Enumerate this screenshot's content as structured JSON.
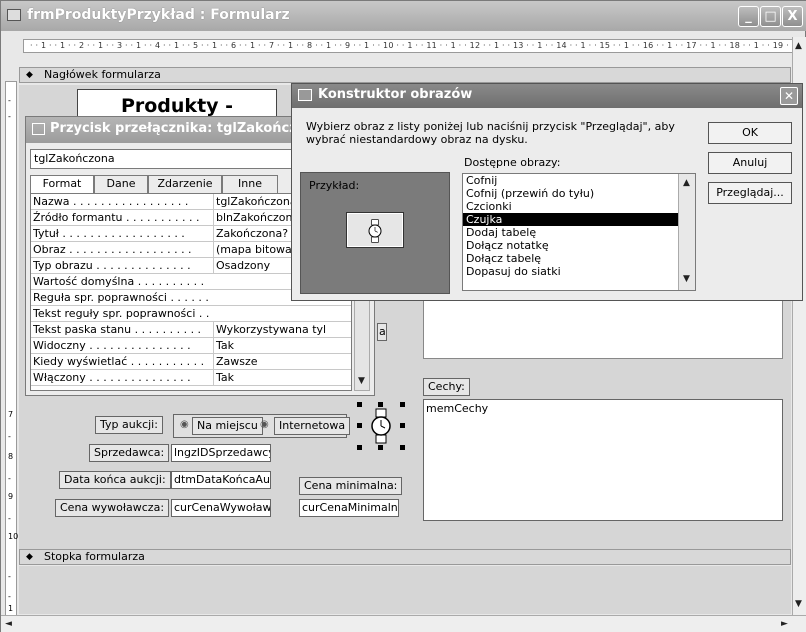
{
  "window": {
    "title": "frmProduktyPrzykład : Formularz",
    "buttons": {
      "minimize": "_",
      "maximize": "□",
      "close": "X"
    }
  },
  "ruler": {
    "horizontal": "· · 1 · · 1 · · 2 · · 1 · · 3 · · 1 · · 4 · · 1 · · 5 · · 1 · · 6 · · 1 · · 7 · · 1 · · 8 · · 1 · · 9 · · 1 · · 10 · · 1 · · 11 · · 1 · · 12 · · 1 · · 13 · · 1 · · 14 · · 1 · · 15 · · 1 · · 16 · · 1 · · 17 · · 1 · · 18 · · 1 · · 19 ·",
    "vertical_marks": [
      "-",
      "-",
      "7",
      "-",
      "8",
      "-",
      "9",
      "-",
      "10",
      "-",
      "1",
      "-"
    ]
  },
  "sections": {
    "header": "Nagłówek formularza",
    "footer": "Stopka formularza"
  },
  "form": {
    "title": "Produkty - przykład",
    "labels": {
      "auction_type": "Typ aukcji:",
      "seller": "Sprzedawca:",
      "end_date": "Data końca aukcji:",
      "start_price": "Cena wywoławcza:",
      "min_price": "Cena minimalna:",
      "features": "Cechy:"
    },
    "radios": {
      "on_site": "Na miejscu",
      "internet": "Internetowa"
    },
    "fields": {
      "seller": "lngzIDSprzedawcy",
      "end_date": "dtmDataKońcaAukc",
      "start_price": "curCenaWywoławc",
      "min_price": "curCenaMinimalna",
      "features": "memCechy"
    },
    "partial_label": "a"
  },
  "property_sheet": {
    "title": "Przycisk przełącznika: tglZakończona",
    "selected_object": "tglZakończona",
    "tabs": [
      "Format",
      "Dane",
      "Zdarzenie",
      "Inne"
    ],
    "rows": [
      {
        "name": "Nazwa . . . . . . . . . . . . . . . . .",
        "value": "tglZakończona"
      },
      {
        "name": "Źródło formantu . . . . . . . . . . .",
        "value": "blnZakończona"
      },
      {
        "name": "Tytuł . . . . . . . . . . . . . . . . . .",
        "value": "Zakończona?"
      },
      {
        "name": "Obraz . . . . . . . . . . . . . . . . . .",
        "value": "(mapa bitowa)"
      },
      {
        "name": "Typ obrazu . . . . . . . . . . . . . .",
        "value": "Osadzony"
      },
      {
        "name": "Wartość domyślna . . . . . . . . . .",
        "value": ""
      },
      {
        "name": "Reguła spr. poprawności . . . . . .",
        "value": ""
      },
      {
        "name": "Tekst reguły spr. poprawności . .",
        "value": ""
      },
      {
        "name": "Tekst paska stanu . . . . . . . . . .",
        "value": "Wykorzystywana tyl"
      },
      {
        "name": "Widoczny . . . . . . . . . . . . . . .",
        "value": "Tak"
      },
      {
        "name": "Kiedy wyświetlać . . . . . . . . . . .",
        "value": "Zawsze"
      },
      {
        "name": "Włączony . . . . . . . . . . . . . . .",
        "value": "Tak"
      }
    ]
  },
  "picture_builder": {
    "title": "Konstruktor obrazów",
    "instructions": "Wybierz obraz z listy poniżej lub naciśnij przycisk \"Przeglądaj\", aby wybrać niestandardowy obraz na dysku.",
    "ok": "OK",
    "cancel": "Anuluj",
    "browse": "Przeglądaj...",
    "preview_label": "Przykład:",
    "available_label": "Dostępne obrazy:",
    "images": [
      "Cofnij",
      "Cofnij (przewiń do tyłu)",
      "Czcionki",
      "Czujka",
      "Dodaj tabelę",
      "Dołącz notatkę",
      "Dołącz tabelę",
      "Dopasuj do siatki"
    ],
    "selected_index": 3
  },
  "icons": {
    "watch": "watch-icon",
    "scroll_up": "▲",
    "scroll_down": "▼",
    "scroll_left": "◄",
    "scroll_right": "►",
    "header_marker": "◆"
  }
}
